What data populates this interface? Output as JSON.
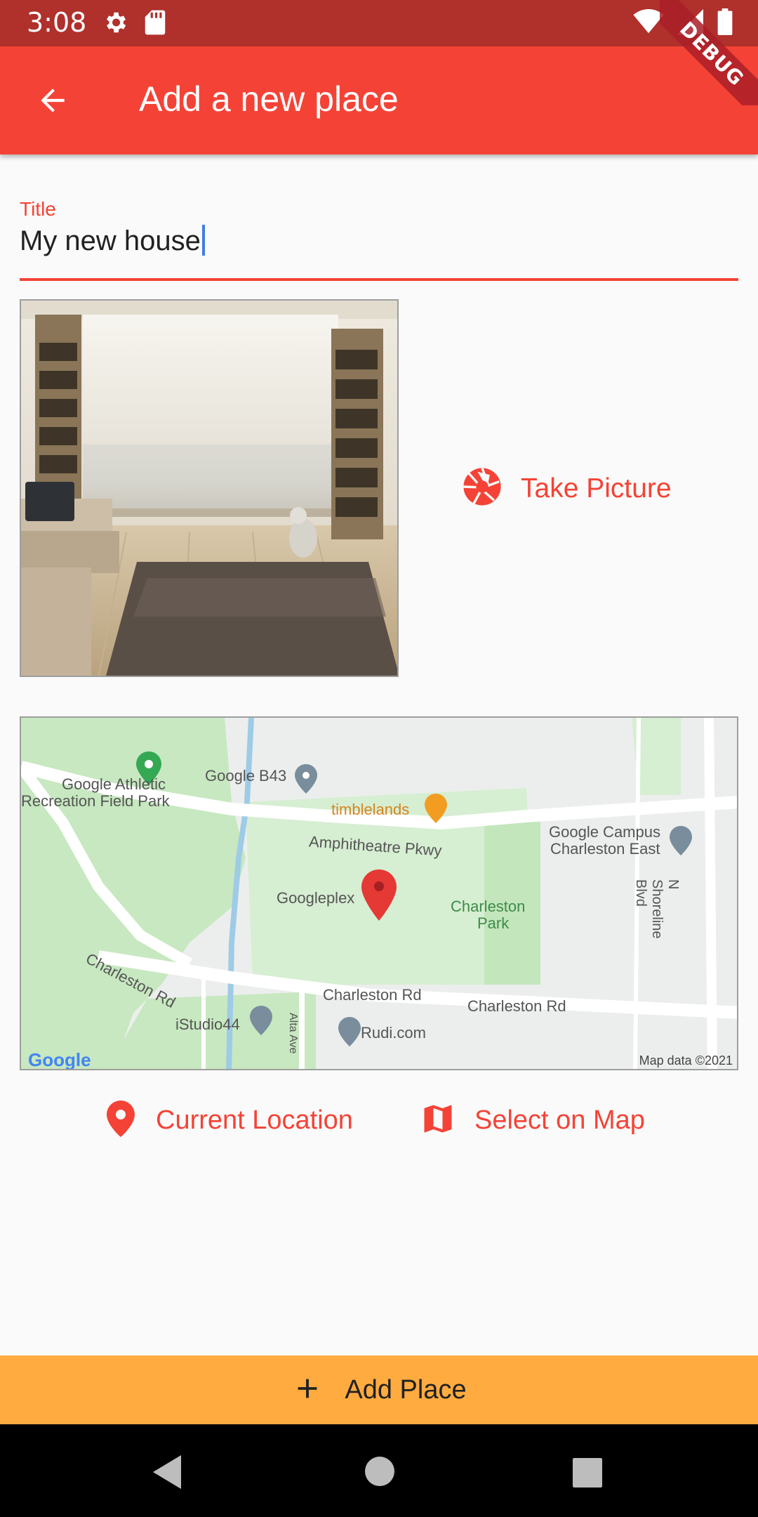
{
  "status_bar": {
    "time": "3:08"
  },
  "debug_banner": "DEBUG",
  "app_bar": {
    "title": "Add a new place"
  },
  "form": {
    "title_label": "Title",
    "title_value": "My new house"
  },
  "image_preview": {
    "alt": "Living room interior"
  },
  "take_picture_label": "Take Picture",
  "map": {
    "places": {
      "athletic_line1": "Google Athletic",
      "athletic_line2": "Recreation Field Park",
      "b43": "Google B43",
      "timblelands": "timblelands",
      "amphitheatre": "Amphitheatre Pkwy",
      "campus_line1": "Google Campus",
      "campus_line2": "Charleston East",
      "googleplex": "Googleplex",
      "charleston_park_line1": "Charleston",
      "charleston_park_line2": "Park",
      "n_shoreline": "N Shoreline Blvd",
      "charleston_rd_left": "Charleston Rd",
      "charleston_rd_mid": "Charleston Rd",
      "charleston_rd_right": "Charleston Rd",
      "istudio": "iStudio44",
      "alta": "Alta Ave",
      "rudi": "Rudi.com"
    },
    "logo": "Google",
    "attribution": "Map data ©2021"
  },
  "location_actions": {
    "current_location": "Current Location",
    "select_on_map": "Select on Map"
  },
  "add_place_label": "Add Place",
  "colors": {
    "primary": "#f44336",
    "status_bar": "#b0302c",
    "accent": "#ffab40"
  }
}
